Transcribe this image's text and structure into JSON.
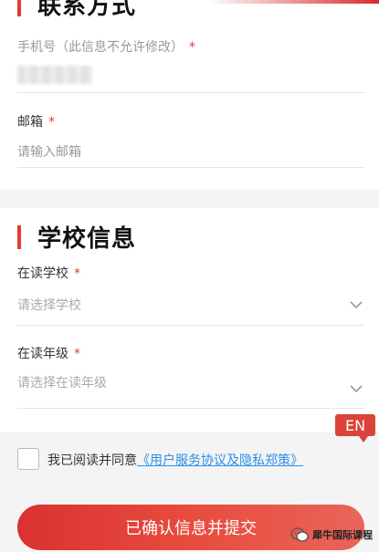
{
  "contact": {
    "section_title": "联系方式",
    "phone_label": "手机号（此信息不允许修改）",
    "phone_required": "*",
    "email_label": "邮箱",
    "email_required": "*",
    "email_placeholder": "请输入邮箱"
  },
  "school": {
    "section_title": "学校信息",
    "school_label": "在读学校",
    "school_required": "*",
    "school_placeholder": "请选择学校",
    "grade_label": "在读年级",
    "grade_required": "*",
    "grade_placeholder": "请选择在读年级"
  },
  "lang_badge": "EN",
  "agreement": {
    "prefix": "我已阅读并同意",
    "link": "《用户服务协议及隐私郑策》"
  },
  "submit_label": "已确认信息并提交",
  "watermark": "犀牛国际课程",
  "colors": {
    "accent": "#e23b30",
    "link": "#2b90e8"
  }
}
